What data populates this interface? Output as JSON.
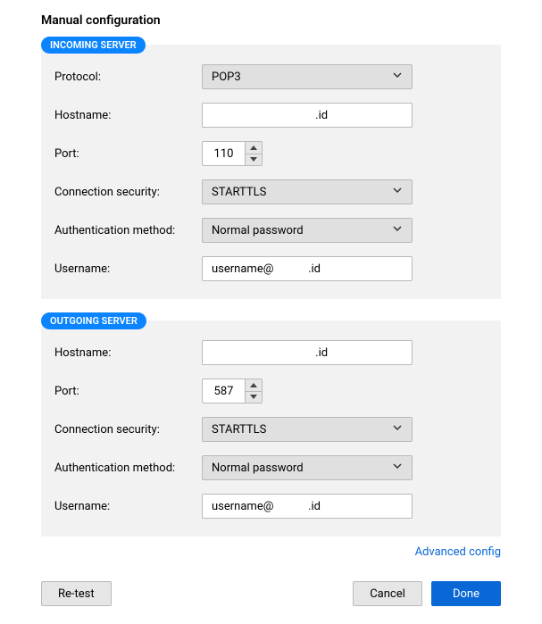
{
  "title": "Manual configuration",
  "incoming": {
    "badge": "INCOMING SERVER",
    "protocol_label": "Protocol:",
    "protocol_value": "POP3",
    "hostname_label": "Hostname:",
    "hostname_value": "          .id",
    "port_label": "Port:",
    "port_value": "110",
    "security_label": "Connection security:",
    "security_value": "STARTTLS",
    "auth_label": "Authentication method:",
    "auth_value": "Normal password",
    "username_label": "Username:",
    "username_value": "username@            .id"
  },
  "outgoing": {
    "badge": "OUTGOING SERVER",
    "hostname_label": "Hostname:",
    "hostname_value": "          .id",
    "port_label": "Port:",
    "port_value": "587",
    "security_label": "Connection security:",
    "security_value": "STARTTLS",
    "auth_label": "Authentication method:",
    "auth_value": "Normal password",
    "username_label": "Username:",
    "username_value": "username@            .id"
  },
  "links": {
    "advanced": "Advanced config"
  },
  "buttons": {
    "retest": "Re-test",
    "cancel": "Cancel",
    "done": "Done"
  }
}
